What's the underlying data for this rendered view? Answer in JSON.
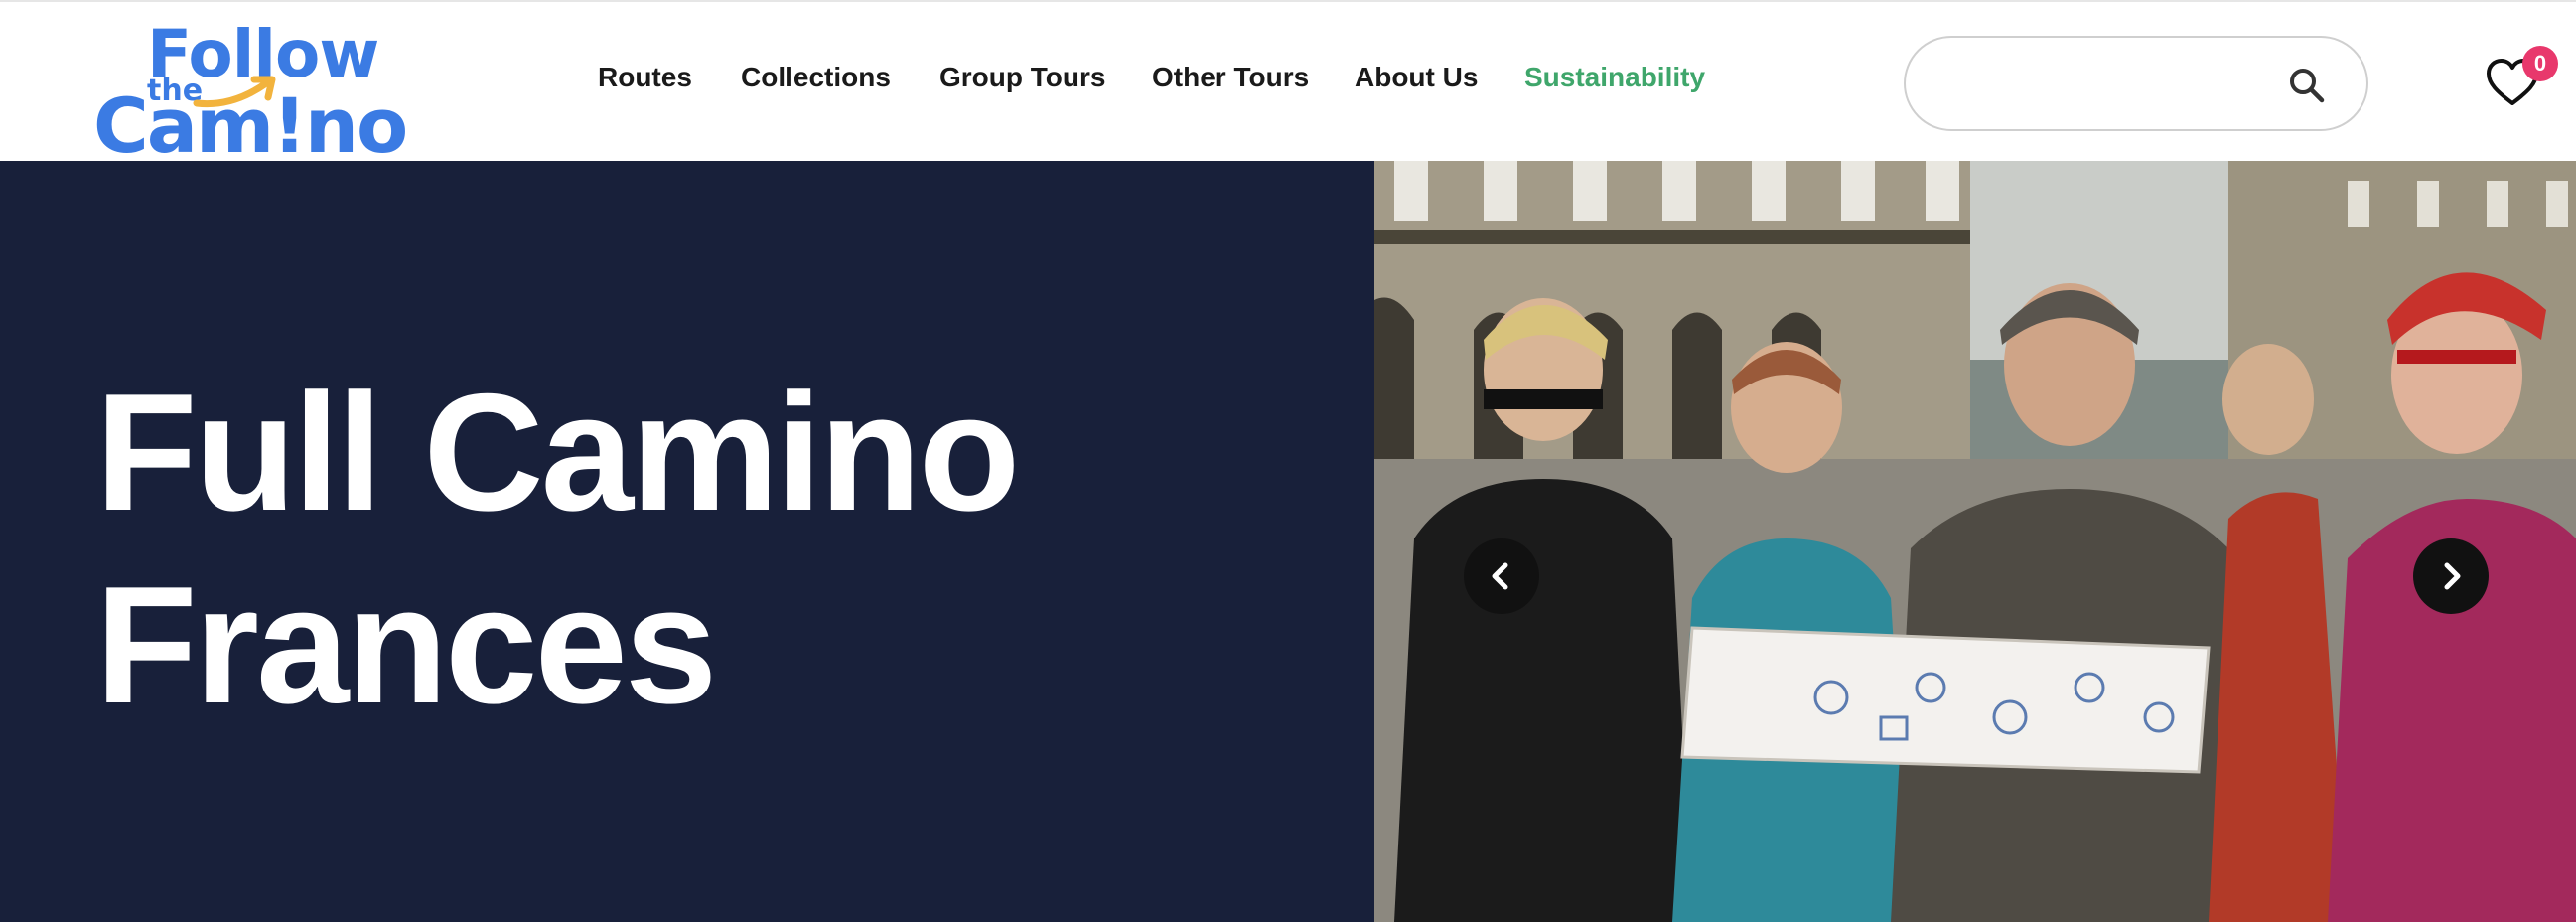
{
  "logo": {
    "line1": "Follow",
    "line2": "the",
    "line3": "Cam!no"
  },
  "nav": {
    "items": [
      {
        "label": "Routes"
      },
      {
        "label": "Collections"
      },
      {
        "label": "Group Tours"
      },
      {
        "label": "Other Tours"
      },
      {
        "label": "About Us"
      },
      {
        "label": "Sustainability"
      }
    ]
  },
  "search": {
    "value": "",
    "placeholder": ""
  },
  "wishlist": {
    "count": "0"
  },
  "hero": {
    "title": "Full Camino Frances"
  },
  "colors": {
    "brand_blue": "#3b7be3",
    "accent_orange": "#f2b33d",
    "sustainability_green": "#3fa66b",
    "hero_navy": "#18203a",
    "badge_pink": "#e8386c"
  },
  "icons": {
    "search": "search-icon",
    "wishlist": "heart-icon",
    "prev": "chevron-left-icon",
    "next": "chevron-right-icon"
  }
}
